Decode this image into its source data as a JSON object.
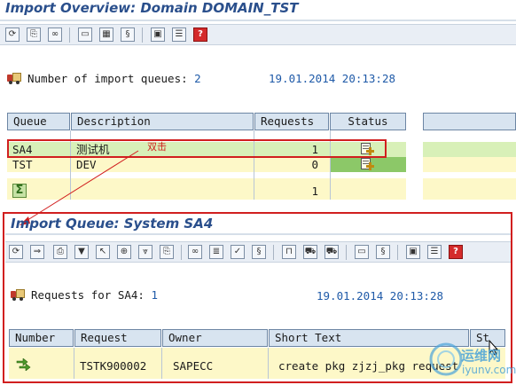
{
  "overview": {
    "title": "Import Overview: Domain DOMAIN_TST",
    "summary_label": "Number of import queues:",
    "summary_count": "2",
    "date": "19.01.2014",
    "time": "20:13:28",
    "columns": [
      "Queue",
      "Description",
      "Requests",
      "Status"
    ],
    "rows": [
      {
        "queue": "SA4",
        "description": "测试机",
        "requests": "1"
      },
      {
        "queue": "TST",
        "description": "DEV",
        "requests": "0"
      }
    ],
    "total": "1",
    "toolbar_icons": [
      "refresh-icon",
      "open-queue-icon",
      "glasses-icon",
      "screen-icon",
      "transport-routes-icon",
      "scroll-icon",
      "print-settings-icon",
      "list-icon",
      "help-icon"
    ]
  },
  "annotation": {
    "label": "双击"
  },
  "queue": {
    "title": "Import Queue: System SA4",
    "summary_label": "Requests for SA4:",
    "summary_count": "1",
    "date": "19.01.2014",
    "time": "20:13:28",
    "columns": [
      "Number",
      "Request",
      "Owner",
      "Short Text",
      "St"
    ],
    "rows": [
      {
        "request": "TSTK900002",
        "owner": "SAPECC",
        "short_text": "create pkg zjzj_pkg request"
      }
    ],
    "toolbar_icons": [
      "refresh-icon",
      "import-icon",
      "print-icon",
      "filter-icon",
      "select-icon",
      "zoom-icon",
      "filter-funnel-icon",
      "open-queue-icon",
      "glasses-icon",
      "list-detail-icon",
      "check-icon",
      "scroll-icon",
      "lock-icon",
      "truck-import-icon",
      "truck-all-icon",
      "screen-icon",
      "scroll-icon",
      "print-settings-icon",
      "list-icon",
      "help-icon"
    ]
  },
  "watermark": {
    "text": "运维网",
    "url": "iyunv.com"
  },
  "colors": {
    "title_blue": "#2a4f8c",
    "date_blue": "#1f5aa8",
    "row_green": "#d8f0b8",
    "row_yellow": "#fdf8c8",
    "status_green": "#8cc868",
    "annotation_red": "#d11f1f"
  }
}
